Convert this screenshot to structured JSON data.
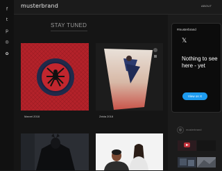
{
  "brand": {
    "logo": "musterbrand"
  },
  "header": {
    "about": "ABOUT"
  },
  "social": [
    {
      "name": "facebook-icon",
      "glyph": "f"
    },
    {
      "name": "twitter-icon",
      "glyph": "t"
    },
    {
      "name": "pinterest-icon",
      "glyph": "p"
    },
    {
      "name": "instagram-icon",
      "glyph": "◎"
    },
    {
      "name": "snapchat-icon",
      "glyph": "✿"
    }
  ],
  "main": {
    "title": "STAY TUNED",
    "cards": [
      {
        "caption": "Marvel 2018"
      },
      {
        "caption": "Zelda 2018"
      },
      {
        "caption": ""
      },
      {
        "caption": ""
      }
    ]
  },
  "widget": {
    "handle": "#musterbrand",
    "x_glyph": "𝕏",
    "message": "Nothing to see here - yet",
    "button": "View on X"
  },
  "instagram": {
    "label": "musterbrand"
  },
  "colors": {
    "accent": "#1d9bf0",
    "background": "#1b1b1b",
    "card_red": "#b3222a"
  }
}
